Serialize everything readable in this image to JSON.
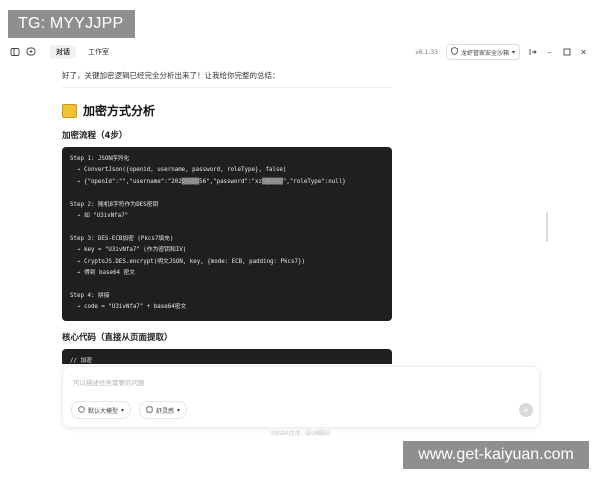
{
  "overlay": {
    "tg_label": "TG: MYYJJPP",
    "watermark": "www.get-kaiyuan.com"
  },
  "titlebar": {
    "tabs": [
      {
        "label": "对话",
        "active": true
      },
      {
        "label": "工作室",
        "active": false
      }
    ],
    "version": "v6.1.33",
    "security_badge": "龙虾管家安全沙箱",
    "icons": [
      "sidebar-toggle-icon",
      "new-chat-icon",
      "shield-icon",
      "chevron-down-icon",
      "share-icon",
      "minimize-icon",
      "maximize-icon",
      "close-icon"
    ]
  },
  "message": {
    "intro": "好了，关键加密逻辑已经完全分析出来了！让我给你完整的总结：",
    "heading": "加密方式分析",
    "subheading_flow": "加密流程（4步）",
    "code_flow": "Step 1: JSON序列化\n  → ConvertJson({openid, username, password, roleType}, false)\n  → {\"openId\":\"\",\"username\":\"202▒▒▒▒▒56\",\"password\":\"xz▒▒▒▒▒▒\",\"roleType\":null}\n\nStep 2: 随机8字符作为DES密钥\n  → 如 \"U3ivNfa7\"\n\nStep 3: DES-ECB加密 (Pkcs7填充)\n  → key = \"U3ivNfa7\" (作为密钥和IV)\n  → CryptoJS.DES.encrypt(明文JSON, key, {mode: ECB, padding: Pkcs7})\n  → 得到 base64 密文\n\nStep 4: 拼接\n  → code = \"U3ivNfa7\" + base64密文",
    "subheading_code": "核心代码（直接从页面提取）",
    "code_core": "// 加密\nfunction encryptByDES(str) {"
  },
  "composer": {
    "placeholder": "可以描述任务需要的问题",
    "model_chip": "默认大模型",
    "style_chip": "舒灵感"
  },
  "footer": "内容由AI生成，请仔细甄别"
}
